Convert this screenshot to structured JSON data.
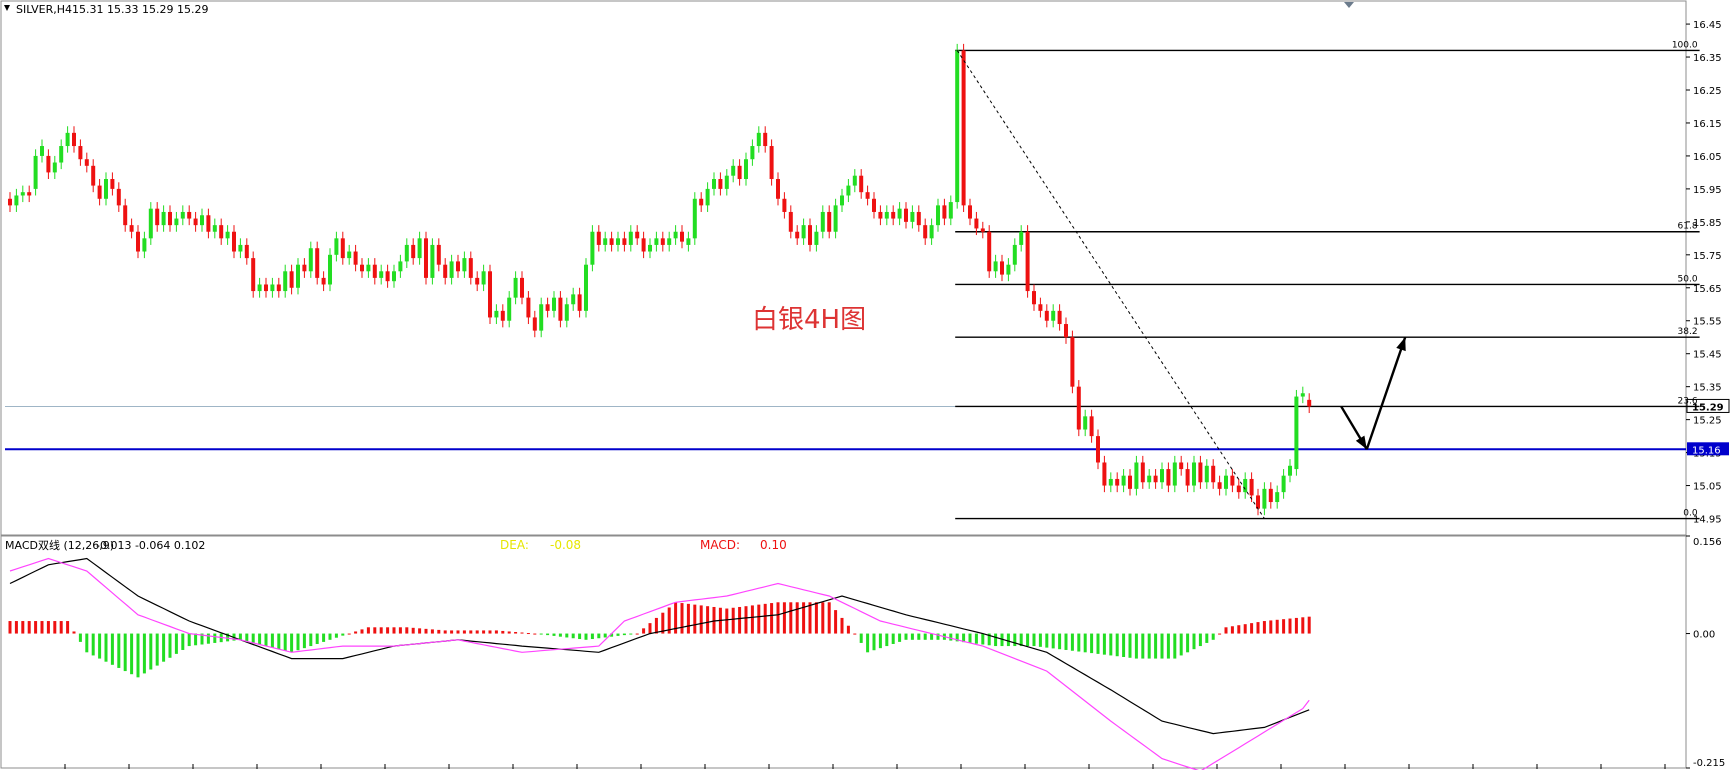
{
  "window": {
    "title": "SILVER,H4",
    "ohlc": "15.31 15.33 15.29 15.29",
    "annotation": "白银4H图",
    "colors": {
      "up": "#22dd22",
      "down": "#ee1111",
      "ma": "#000000",
      "support": "#0000cc",
      "bid": "#9fb5c6",
      "signal": "#ff44ff",
      "macd_line": "#000000",
      "accent_yellow": "#e6e600",
      "accent_red": "#ee1111"
    }
  },
  "chart_data": [
    {
      "type": "candlestick",
      "title": "SILVER,H4",
      "ylim": [
        14.9,
        16.52
      ],
      "yticks": [
        "16.45",
        "16.35",
        "16.25",
        "16.15",
        "16.05",
        "15.95",
        "15.85",
        "15.75",
        "15.65",
        "15.55",
        "15.45",
        "15.35",
        "15.25",
        "15.15",
        "15.05",
        "14.95"
      ],
      "current_price": "15.29",
      "support_price": "15.16",
      "support_value": 15.16,
      "current_value": 15.29,
      "fibonacci": [
        {
          "label": "100.0",
          "value": 16.37
        },
        {
          "label": "61.8",
          "value": 15.82
        },
        {
          "label": "50.0",
          "value": 15.66
        },
        {
          "label": "38.2",
          "value": 15.5
        },
        {
          "label": "23.6",
          "value": 15.29
        },
        {
          "label": "0.0",
          "value": 14.95
        }
      ],
      "fib_start_index": 148,
      "fib_end_index": 264,
      "trendline": {
        "from_index": 148,
        "from_value": 16.37,
        "to_index": 196,
        "to_value": 14.95
      },
      "projection": [
        {
          "index": 208,
          "value": 15.29
        },
        {
          "index": 212,
          "value": 15.16
        },
        {
          "index": 218,
          "value": 15.5
        }
      ],
      "candles": [
        {
          "o": 15.92,
          "c": 15.9
        },
        {
          "o": 15.9,
          "c": 15.93
        },
        {
          "o": 15.93,
          "c": 15.94
        },
        {
          "o": 15.94,
          "c": 15.93
        },
        {
          "o": 15.95,
          "c": 16.05
        },
        {
          "o": 16.05,
          "c": 16.08
        },
        {
          "o": 16.05,
          "c": 16.0
        },
        {
          "o": 16.0,
          "c": 16.03
        },
        {
          "o": 16.03,
          "c": 16.08
        },
        {
          "o": 16.08,
          "c": 16.12
        },
        {
          "o": 16.12,
          "c": 16.08
        },
        {
          "o": 16.08,
          "c": 16.04
        },
        {
          "o": 16.04,
          "c": 16.02
        },
        {
          "o": 16.02,
          "c": 15.96
        },
        {
          "o": 15.96,
          "c": 15.92
        },
        {
          "o": 15.92,
          "c": 15.98
        },
        {
          "o": 15.98,
          "c": 15.95
        },
        {
          "o": 15.95,
          "c": 15.9
        },
        {
          "o": 15.9,
          "c": 15.84
        },
        {
          "o": 15.84,
          "c": 15.82
        },
        {
          "o": 15.82,
          "c": 15.76
        },
        {
          "o": 15.76,
          "c": 15.8
        },
        {
          "o": 15.8,
          "c": 15.89
        },
        {
          "o": 15.89,
          "c": 15.84
        },
        {
          "o": 15.84,
          "c": 15.88
        },
        {
          "o": 15.88,
          "c": 15.84
        },
        {
          "o": 15.84,
          "c": 15.86
        },
        {
          "o": 15.86,
          "c": 15.88
        },
        {
          "o": 15.88,
          "c": 15.86
        },
        {
          "o": 15.86,
          "c": 15.84
        },
        {
          "o": 15.84,
          "c": 15.87
        },
        {
          "o": 15.87,
          "c": 15.82
        },
        {
          "o": 15.82,
          "c": 15.84
        },
        {
          "o": 15.84,
          "c": 15.8
        },
        {
          "o": 15.8,
          "c": 15.82
        },
        {
          "o": 15.82,
          "c": 15.76
        },
        {
          "o": 15.76,
          "c": 15.78
        },
        {
          "o": 15.78,
          "c": 15.74
        },
        {
          "o": 15.74,
          "c": 15.64
        },
        {
          "o": 15.64,
          "c": 15.66
        },
        {
          "o": 15.66,
          "c": 15.64
        },
        {
          "o": 15.64,
          "c": 15.66
        },
        {
          "o": 15.66,
          "c": 15.64
        },
        {
          "o": 15.64,
          "c": 15.7
        },
        {
          "o": 15.7,
          "c": 15.65
        },
        {
          "o": 15.65,
          "c": 15.72
        },
        {
          "o": 15.72,
          "c": 15.7
        },
        {
          "o": 15.7,
          "c": 15.77
        },
        {
          "o": 15.77,
          "c": 15.68
        },
        {
          "o": 15.68,
          "c": 15.66
        },
        {
          "o": 15.66,
          "c": 15.75
        },
        {
          "o": 15.75,
          "c": 15.8
        },
        {
          "o": 15.8,
          "c": 15.74
        },
        {
          "o": 15.74,
          "c": 15.76
        },
        {
          "o": 15.76,
          "c": 15.72
        },
        {
          "o": 15.72,
          "c": 15.7
        },
        {
          "o": 15.7,
          "c": 15.72
        },
        {
          "o": 15.72,
          "c": 15.68
        },
        {
          "o": 15.68,
          "c": 15.7
        },
        {
          "o": 15.7,
          "c": 15.67
        },
        {
          "o": 15.67,
          "c": 15.7
        },
        {
          "o": 15.7,
          "c": 15.73
        },
        {
          "o": 15.73,
          "c": 15.78
        },
        {
          "o": 15.78,
          "c": 15.74
        },
        {
          "o": 15.74,
          "c": 15.8
        },
        {
          "o": 15.8,
          "c": 15.68
        },
        {
          "o": 15.68,
          "c": 15.78
        },
        {
          "o": 15.78,
          "c": 15.72
        },
        {
          "o": 15.72,
          "c": 15.68
        },
        {
          "o": 15.68,
          "c": 15.73
        },
        {
          "o": 15.73,
          "c": 15.7
        },
        {
          "o": 15.7,
          "c": 15.74
        },
        {
          "o": 15.74,
          "c": 15.68
        },
        {
          "o": 15.68,
          "c": 15.66
        },
        {
          "o": 15.66,
          "c": 15.7
        },
        {
          "o": 15.7,
          "c": 15.56
        },
        {
          "o": 15.56,
          "c": 15.58
        },
        {
          "o": 15.58,
          "c": 15.55
        },
        {
          "o": 15.55,
          "c": 15.62
        },
        {
          "o": 15.62,
          "c": 15.68
        },
        {
          "o": 15.68,
          "c": 15.62
        },
        {
          "o": 15.62,
          "c": 15.56
        },
        {
          "o": 15.56,
          "c": 15.52
        },
        {
          "o": 15.52,
          "c": 15.6
        },
        {
          "o": 15.6,
          "c": 15.58
        },
        {
          "o": 15.58,
          "c": 15.62
        },
        {
          "o": 15.62,
          "c": 15.55
        },
        {
          "o": 15.55,
          "c": 15.6
        },
        {
          "o": 15.6,
          "c": 15.63
        },
        {
          "o": 15.63,
          "c": 15.58
        },
        {
          "o": 15.58,
          "c": 15.72
        },
        {
          "o": 15.72,
          "c": 15.82
        },
        {
          "o": 15.82,
          "c": 15.78
        },
        {
          "o": 15.78,
          "c": 15.8
        },
        {
          "o": 15.8,
          "c": 15.78
        },
        {
          "o": 15.78,
          "c": 15.8
        },
        {
          "o": 15.8,
          "c": 15.78
        },
        {
          "o": 15.78,
          "c": 15.82
        },
        {
          "o": 15.82,
          "c": 15.8
        },
        {
          "o": 15.8,
          "c": 15.76
        },
        {
          "o": 15.76,
          "c": 15.78
        },
        {
          "o": 15.78,
          "c": 15.8
        },
        {
          "o": 15.8,
          "c": 15.78
        },
        {
          "o": 15.78,
          "c": 15.8
        },
        {
          "o": 15.8,
          "c": 15.82
        },
        {
          "o": 15.82,
          "c": 15.79
        },
        {
          "o": 15.78,
          "c": 15.8
        },
        {
          "o": 15.8,
          "c": 15.92
        },
        {
          "o": 15.92,
          "c": 15.9
        },
        {
          "o": 15.9,
          "c": 15.95
        },
        {
          "o": 15.95,
          "c": 15.98
        },
        {
          "o": 15.98,
          "c": 15.95
        },
        {
          "o": 15.95,
          "c": 15.99
        },
        {
          "o": 15.99,
          "c": 16.02
        },
        {
          "o": 16.02,
          "c": 15.98
        },
        {
          "o": 15.98,
          "c": 16.04
        },
        {
          "o": 16.04,
          "c": 16.08
        },
        {
          "o": 16.08,
          "c": 16.12
        },
        {
          "o": 16.12,
          "c": 16.08
        },
        {
          "o": 16.08,
          "c": 15.98
        },
        {
          "o": 15.98,
          "c": 15.92
        },
        {
          "o": 15.92,
          "c": 15.88
        },
        {
          "o": 15.88,
          "c": 15.82
        },
        {
          "o": 15.82,
          "c": 15.8
        },
        {
          "o": 15.8,
          "c": 15.84
        },
        {
          "o": 15.84,
          "c": 15.78
        },
        {
          "o": 15.78,
          "c": 15.82
        },
        {
          "o": 15.82,
          "c": 15.88
        },
        {
          "o": 15.88,
          "c": 15.82
        },
        {
          "o": 15.82,
          "c": 15.9
        },
        {
          "o": 15.9,
          "c": 15.93
        },
        {
          "o": 15.93,
          "c": 15.96
        },
        {
          "o": 15.96,
          "c": 15.99
        },
        {
          "o": 15.99,
          "c": 15.94
        },
        {
          "o": 15.94,
          "c": 15.92
        },
        {
          "o": 15.92,
          "c": 15.88
        },
        {
          "o": 15.88,
          "c": 15.86
        },
        {
          "o": 15.86,
          "c": 15.88
        },
        {
          "o": 15.88,
          "c": 15.86
        },
        {
          "o": 15.86,
          "c": 15.89
        },
        {
          "o": 15.89,
          "c": 15.85
        },
        {
          "o": 15.85,
          "c": 15.88
        },
        {
          "o": 15.88,
          "c": 15.84
        },
        {
          "o": 15.84,
          "c": 15.8
        },
        {
          "o": 15.8,
          "c": 15.84
        },
        {
          "o": 15.84,
          "c": 15.9
        },
        {
          "o": 15.9,
          "c": 15.86
        },
        {
          "o": 15.86,
          "c": 15.91
        },
        {
          "o": 15.91,
          "c": 16.37
        },
        {
          "o": 16.37,
          "c": 15.9
        },
        {
          "o": 15.9,
          "c": 15.86
        },
        {
          "o": 15.86,
          "c": 15.83
        },
        {
          "o": 15.83,
          "c": 15.82
        },
        {
          "o": 15.82,
          "c": 15.7
        },
        {
          "o": 15.7,
          "c": 15.73
        },
        {
          "o": 15.73,
          "c": 15.69
        },
        {
          "o": 15.69,
          "c": 15.72
        },
        {
          "o": 15.72,
          "c": 15.78
        },
        {
          "o": 15.78,
          "c": 15.82
        },
        {
          "o": 15.82,
          "c": 15.64
        },
        {
          "o": 15.64,
          "c": 15.6
        },
        {
          "o": 15.6,
          "c": 15.58
        },
        {
          "o": 15.58,
          "c": 15.55
        },
        {
          "o": 15.55,
          "c": 15.58
        },
        {
          "o": 15.58,
          "c": 15.54
        },
        {
          "o": 15.54,
          "c": 15.5
        },
        {
          "o": 15.5,
          "c": 15.35
        },
        {
          "o": 15.35,
          "c": 15.22
        },
        {
          "o": 15.22,
          "c": 15.26
        },
        {
          "o": 15.26,
          "c": 15.2
        },
        {
          "o": 15.2,
          "c": 15.12
        },
        {
          "o": 15.12,
          "c": 15.05
        },
        {
          "o": 15.05,
          "c": 15.07
        },
        {
          "o": 15.07,
          "c": 15.05
        },
        {
          "o": 15.05,
          "c": 15.08
        },
        {
          "o": 15.08,
          "c": 15.04
        },
        {
          "o": 15.04,
          "c": 15.12
        },
        {
          "o": 15.12,
          "c": 15.06
        },
        {
          "o": 15.06,
          "c": 15.08
        },
        {
          "o": 15.08,
          "c": 15.06
        },
        {
          "o": 15.06,
          "c": 15.1
        },
        {
          "o": 15.1,
          "c": 15.05
        },
        {
          "o": 15.05,
          "c": 15.12
        },
        {
          "o": 15.12,
          "c": 15.1
        },
        {
          "o": 15.1,
          "c": 15.05
        },
        {
          "o": 15.05,
          "c": 15.12
        },
        {
          "o": 15.12,
          "c": 15.06
        },
        {
          "o": 15.06,
          "c": 15.11
        },
        {
          "o": 15.11,
          "c": 15.06
        },
        {
          "o": 15.06,
          "c": 15.04
        },
        {
          "o": 15.04,
          "c": 15.08
        },
        {
          "o": 15.08,
          "c": 15.05
        },
        {
          "o": 15.05,
          "c": 15.03
        },
        {
          "o": 15.03,
          "c": 15.07
        },
        {
          "o": 15.07,
          "c": 15.02
        },
        {
          "o": 15.02,
          "c": 14.98
        },
        {
          "o": 14.98,
          "c": 15.04
        },
        {
          "o": 15.04,
          "c": 15.0
        },
        {
          "o": 15.0,
          "c": 15.03
        },
        {
          "o": 15.03,
          "c": 15.08
        },
        {
          "o": 15.08,
          "c": 15.11
        },
        {
          "o": 15.1,
          "c": 15.32
        },
        {
          "o": 15.32,
          "c": 15.33
        },
        {
          "o": 15.31,
          "c": 15.29
        }
      ]
    },
    {
      "type": "histogram",
      "title": "MACD双线 (12,26,9)",
      "header_values": "-0.013 -0.064 0.102",
      "dea_label": "DEA:",
      "dea_value": "-0.08",
      "macd_label": "MACD:",
      "macd_value": "0.10",
      "ylim": [
        -0.215,
        0.156
      ],
      "yticks": [
        "0.156",
        "0.00",
        "-0.215"
      ],
      "hist_anchors": [
        [
          0,
          0.02
        ],
        [
          9,
          0.02
        ],
        [
          12,
          -0.03
        ],
        [
          20,
          -0.07
        ],
        [
          28,
          -0.02
        ],
        [
          36,
          -0.01
        ],
        [
          44,
          -0.03
        ],
        [
          50,
          -0.01
        ],
        [
          56,
          0.01
        ],
        [
          62,
          0.01
        ],
        [
          68,
          0.005
        ],
        [
          76,
          0.005
        ],
        [
          82,
          0.0
        ],
        [
          90,
          -0.01
        ],
        [
          98,
          0.0
        ],
        [
          104,
          0.05
        ],
        [
          112,
          0.04
        ],
        [
          120,
          0.05
        ],
        [
          128,
          0.05
        ],
        [
          132,
          0.0
        ],
        [
          134,
          -0.03
        ],
        [
          140,
          -0.01
        ],
        [
          146,
          -0.01
        ],
        [
          154,
          -0.02
        ],
        [
          160,
          -0.02
        ],
        [
          168,
          -0.03
        ],
        [
          176,
          -0.04
        ],
        [
          182,
          -0.04
        ],
        [
          188,
          -0.01
        ],
        [
          190,
          0.01
        ],
        [
          196,
          0.02
        ],
        [
          206,
          0.03
        ],
        [
          209,
          0.08
        ],
        [
          211,
          0.102
        ]
      ],
      "dea_anchors": [
        [
          0,
          0.08
        ],
        [
          6,
          0.11
        ],
        [
          12,
          0.12
        ],
        [
          20,
          0.06
        ],
        [
          28,
          0.02
        ],
        [
          36,
          -0.01
        ],
        [
          44,
          -0.04
        ],
        [
          52,
          -0.04
        ],
        [
          60,
          -0.02
        ],
        [
          70,
          -0.01
        ],
        [
          80,
          -0.02
        ],
        [
          92,
          -0.03
        ],
        [
          100,
          0.0
        ],
        [
          110,
          0.02
        ],
        [
          120,
          0.03
        ],
        [
          130,
          0.06
        ],
        [
          140,
          0.03
        ],
        [
          152,
          0.0
        ],
        [
          162,
          -0.03
        ],
        [
          172,
          -0.09
        ],
        [
          180,
          -0.14
        ],
        [
          188,
          -0.16
        ],
        [
          196,
          -0.15
        ],
        [
          206,
          -0.11
        ],
        [
          211,
          -0.064
        ]
      ],
      "macd_anchors": [
        [
          0,
          0.1
        ],
        [
          6,
          0.12
        ],
        [
          12,
          0.1
        ],
        [
          20,
          0.03
        ],
        [
          28,
          0.0
        ],
        [
          36,
          -0.01
        ],
        [
          44,
          -0.03
        ],
        [
          52,
          -0.02
        ],
        [
          60,
          -0.02
        ],
        [
          70,
          -0.01
        ],
        [
          80,
          -0.03
        ],
        [
          92,
          -0.02
        ],
        [
          96,
          0.02
        ],
        [
          104,
          0.05
        ],
        [
          112,
          0.06
        ],
        [
          120,
          0.08
        ],
        [
          128,
          0.06
        ],
        [
          136,
          0.02
        ],
        [
          144,
          0.0
        ],
        [
          152,
          -0.02
        ],
        [
          162,
          -0.06
        ],
        [
          172,
          -0.14
        ],
        [
          180,
          -0.2
        ],
        [
          186,
          -0.22
        ],
        [
          194,
          -0.17
        ],
        [
          202,
          -0.12
        ],
        [
          208,
          -0.04
        ],
        [
          211,
          -0.013
        ]
      ]
    }
  ]
}
